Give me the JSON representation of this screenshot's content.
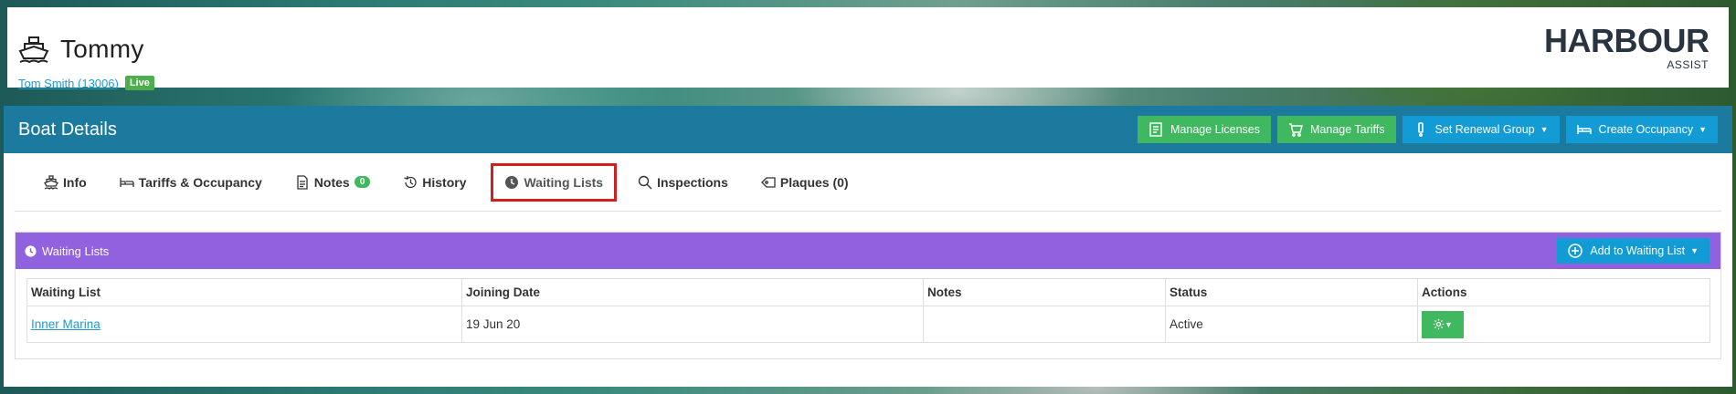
{
  "header": {
    "boat_name": "Tommy",
    "owner_link": "Tom Smith (13006)",
    "status_badge": "Live",
    "logo_main": "HARBOUR",
    "logo_sub": "ASSIST"
  },
  "panel": {
    "title": "Boat Details",
    "buttons": {
      "manage_licenses": "Manage Licenses",
      "manage_tariffs": "Manage Tariffs",
      "set_renewal_group": "Set Renewal Group",
      "create_occupancy": "Create Occupancy"
    }
  },
  "tabs": {
    "info": "Info",
    "tariffs": "Tariffs & Occupancy",
    "notes": "Notes",
    "notes_count": "0",
    "history": "History",
    "waiting_lists": "Waiting Lists",
    "inspections": "Inspections",
    "plaques": "Plaques (0)"
  },
  "waiting_lists": {
    "title": "Waiting Lists",
    "add_button": "Add to Waiting List",
    "columns": [
      "Waiting List",
      "Joining Date",
      "Notes",
      "Status",
      "Actions"
    ],
    "rows": [
      {
        "waiting_list": "Inner Marina",
        "joining_date": "19 Jun 20",
        "notes": "",
        "status": "Active"
      }
    ]
  },
  "colors": {
    "header_blue": "#1c7a9e",
    "purple": "#9162e0",
    "green": "#3fb860",
    "blue": "#139bd6",
    "highlight_red": "#d11f1f"
  }
}
